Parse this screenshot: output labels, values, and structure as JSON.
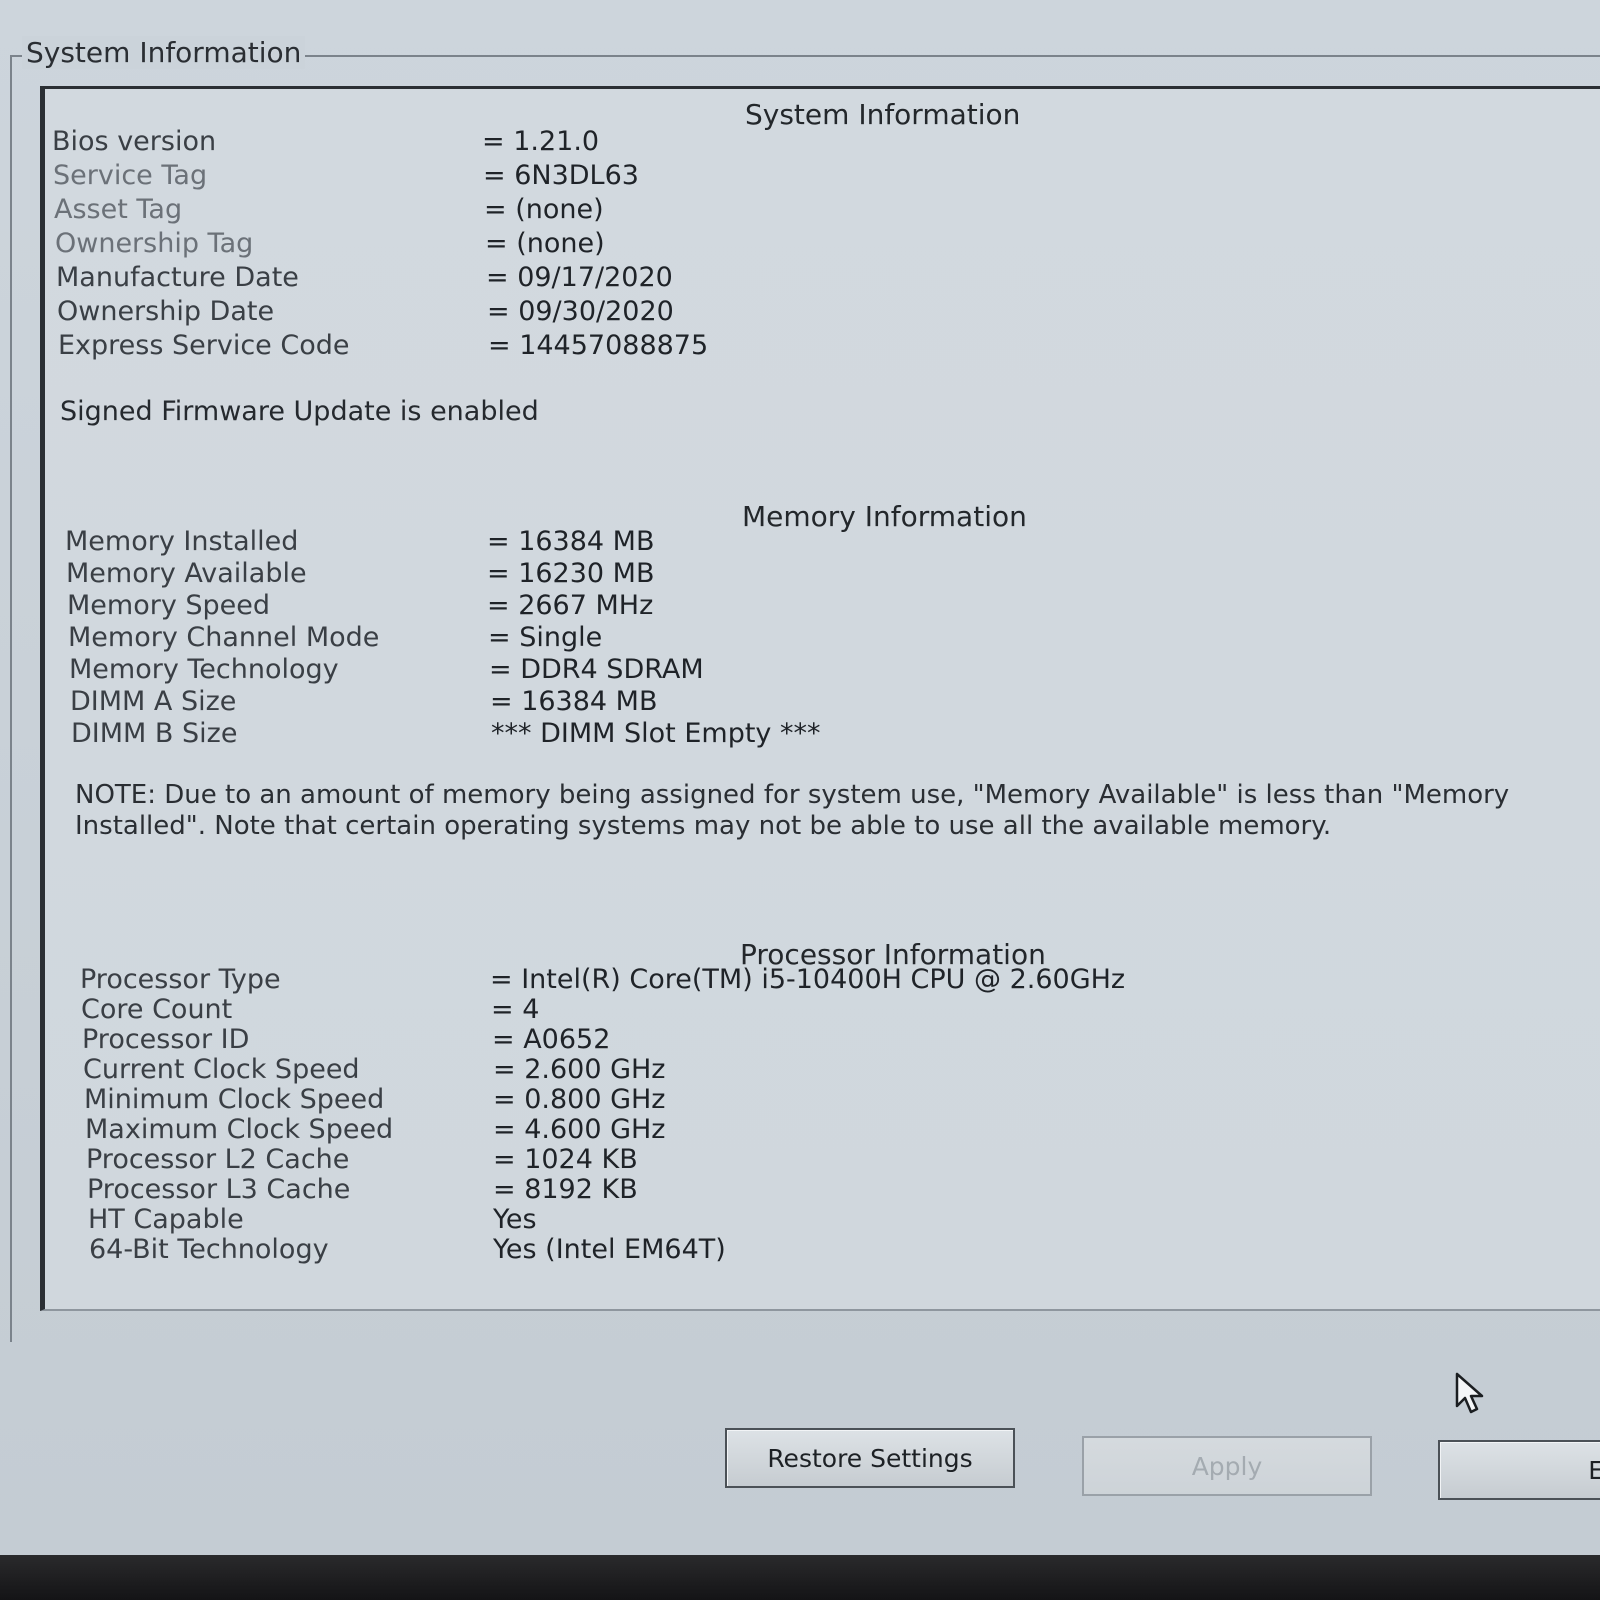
{
  "groupbox_title": "System Information",
  "system": {
    "heading": "System Information",
    "rows": [
      {
        "label": "Bios version",
        "value": "= 1.21.0"
      },
      {
        "label": "Service Tag",
        "value": "= 6N3DL63"
      },
      {
        "label": "Asset Tag",
        "value": "= (none)"
      },
      {
        "label": "Ownership Tag",
        "value": "= (none)"
      },
      {
        "label": "Manufacture Date",
        "value": "= 09/17/2020"
      },
      {
        "label": "Ownership Date",
        "value": "= 09/30/2020"
      },
      {
        "label": "Express Service Code",
        "value": "= 14457088875"
      }
    ],
    "firmware_note": "Signed Firmware Update is enabled"
  },
  "memory": {
    "heading": "Memory Information",
    "rows": [
      {
        "label": "Memory Installed",
        "value": "= 16384 MB"
      },
      {
        "label": "Memory Available",
        "value": "= 16230 MB"
      },
      {
        "label": "Memory Speed",
        "value": "= 2667 MHz"
      },
      {
        "label": "Memory Channel Mode",
        "value": "= Single"
      },
      {
        "label": "Memory Technology",
        "value": "= DDR4 SDRAM"
      },
      {
        "label": "DIMM A Size",
        "value": "= 16384 MB"
      },
      {
        "label": "DIMM B Size",
        "value": "*** DIMM Slot Empty ***"
      }
    ],
    "note": "NOTE: Due to an amount of memory being assigned for system use, \"Memory Available\" is less than \"Memory Installed\". Note that certain operating systems may not be able to use all the available memory."
  },
  "processor": {
    "heading": "Processor Information",
    "rows": [
      {
        "label": "Processor Type",
        "value": "= Intel(R) Core(TM) i5-10400H CPU @ 2.60GHz"
      },
      {
        "label": "Core Count",
        "value": "= 4"
      },
      {
        "label": "Processor ID",
        "value": "= A0652"
      },
      {
        "label": "Current Clock Speed",
        "value": "= 2.600 GHz"
      },
      {
        "label": "Minimum Clock Speed",
        "value": "= 0.800 GHz"
      },
      {
        "label": "Maximum Clock Speed",
        "value": "= 4.600 GHz"
      },
      {
        "label": "Processor L2 Cache",
        "value": "= 1024 KB"
      },
      {
        "label": "Processor L3 Cache",
        "value": "= 8192 KB"
      },
      {
        "label": "HT Capable",
        "value": "Yes"
      },
      {
        "label": "64-Bit Technology",
        "value": "Yes (Intel EM64T)"
      }
    ]
  },
  "buttons": {
    "restore": "Restore Settings",
    "apply": "Apply",
    "exit_partial": "E"
  }
}
